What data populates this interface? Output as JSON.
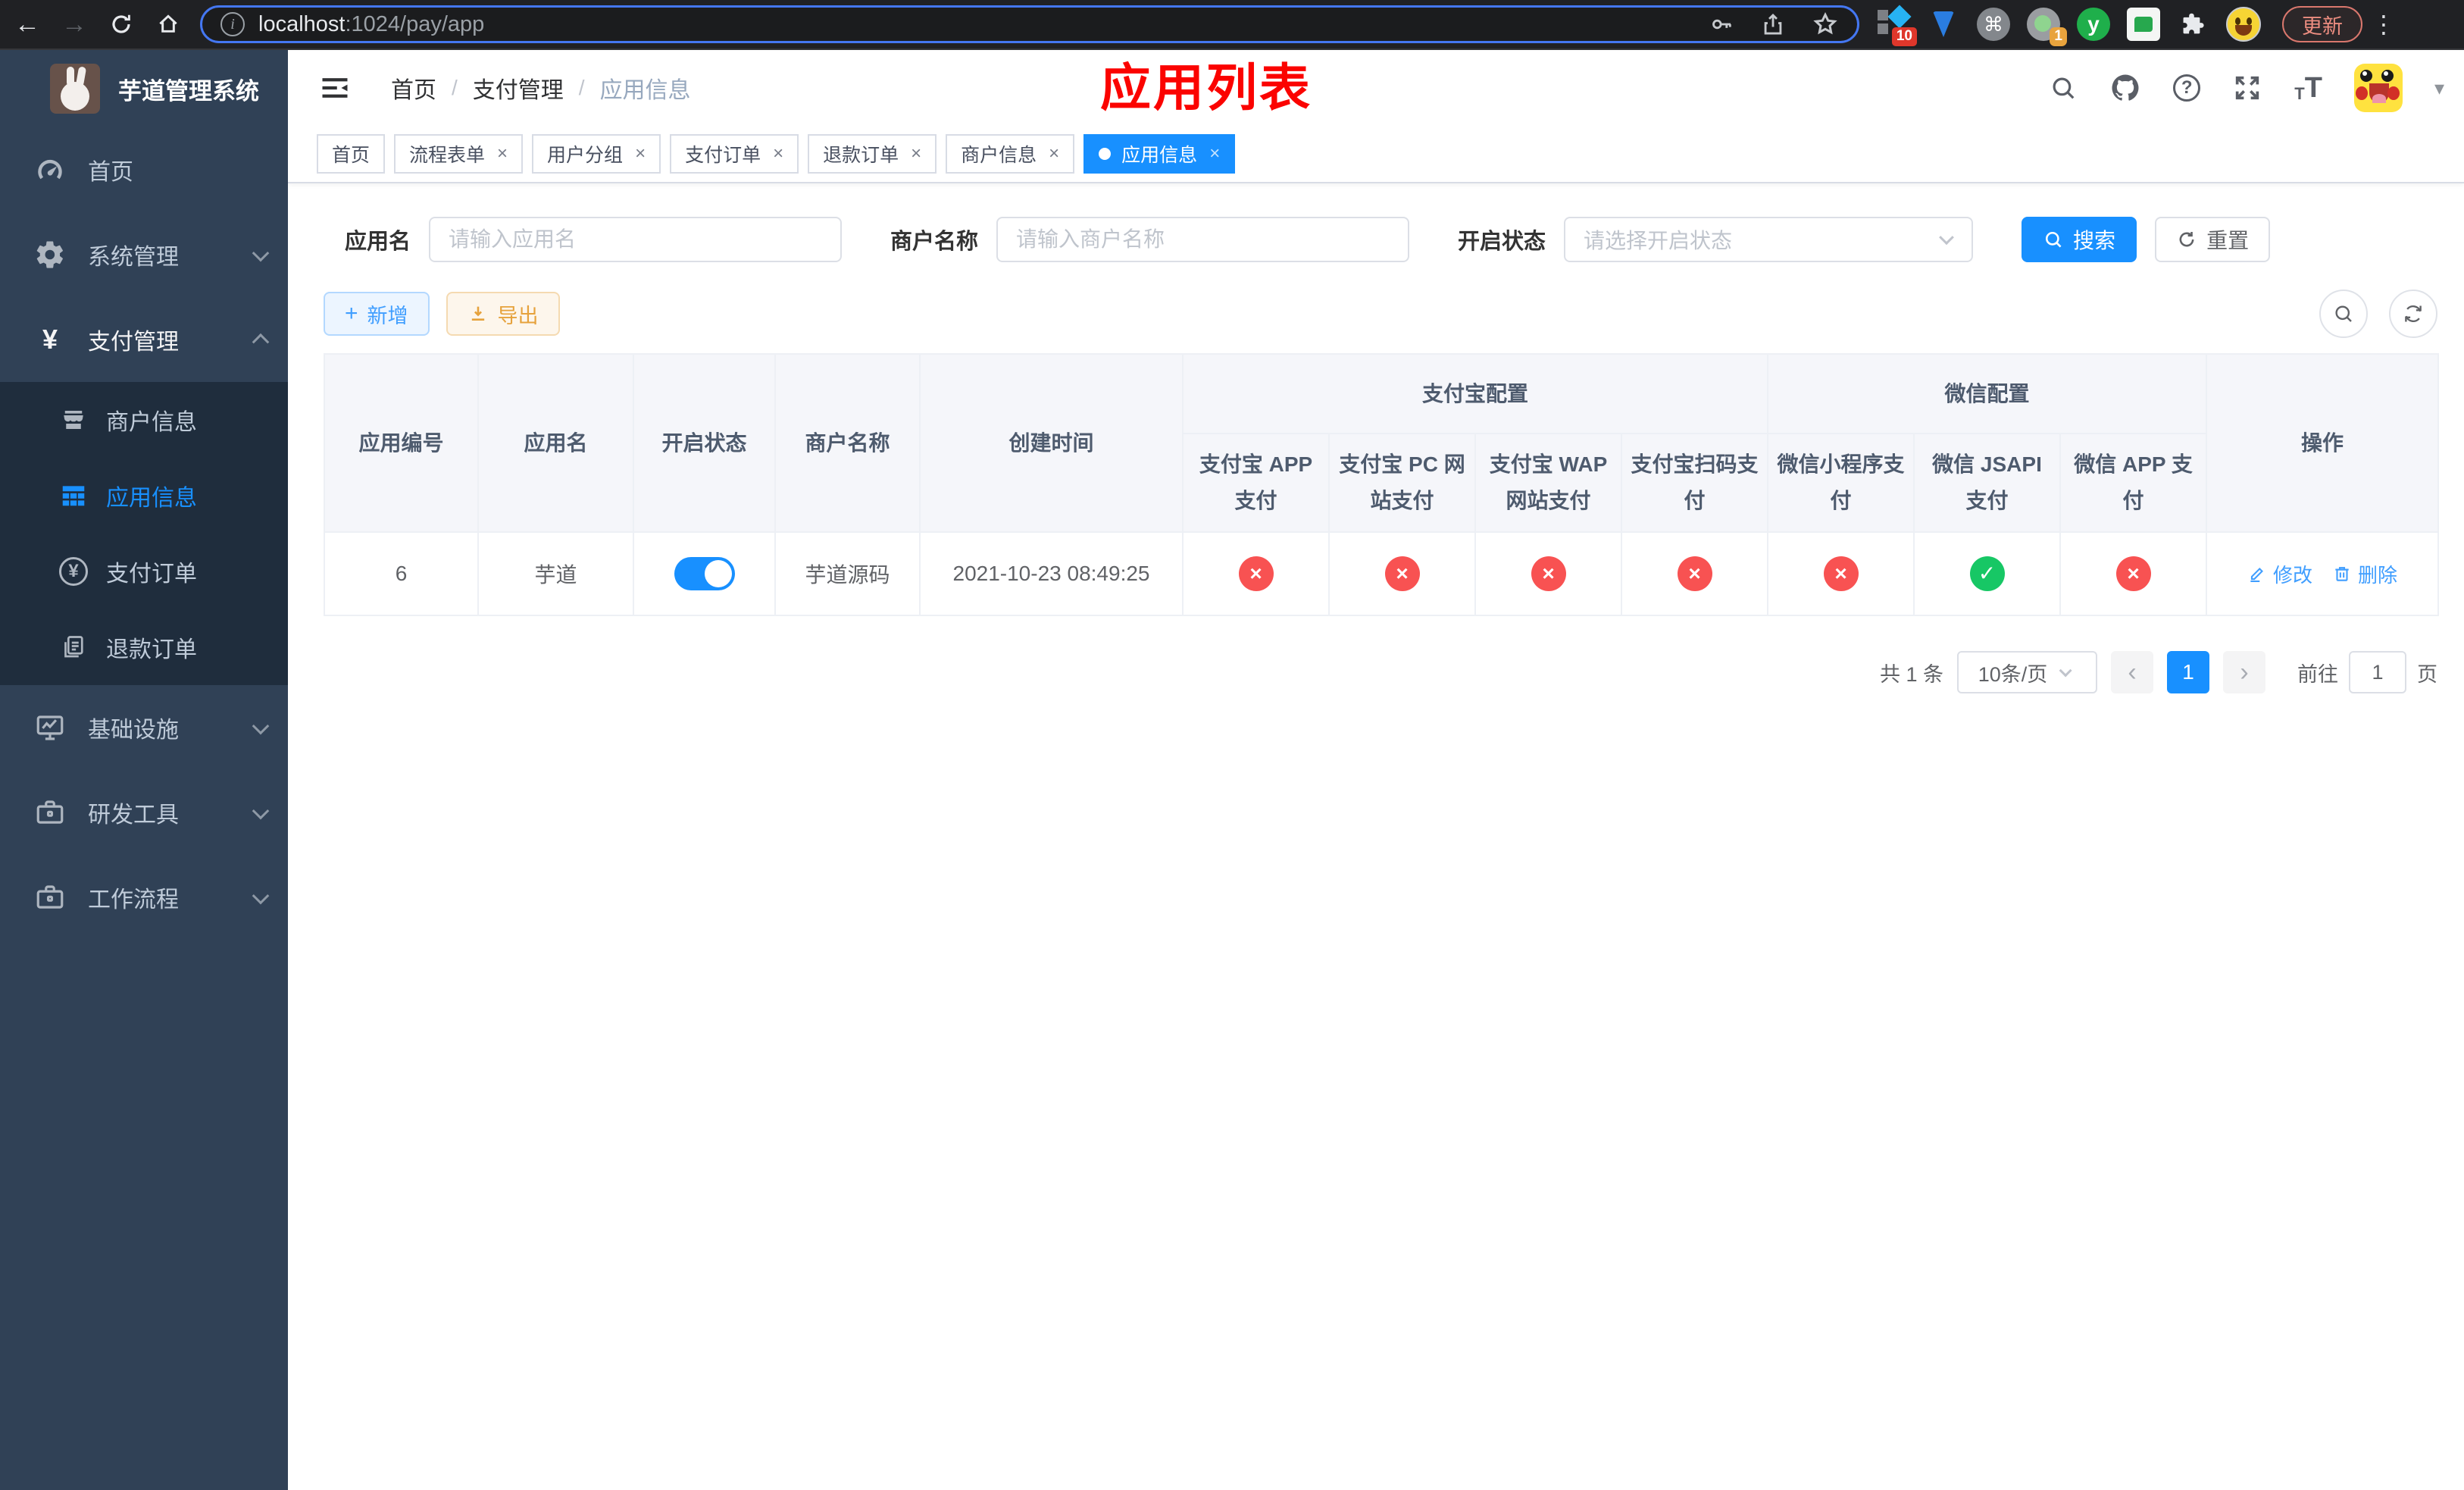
{
  "colors": {
    "accent": "#1890ff",
    "link": "#409eff",
    "danger": "#f85252",
    "success": "#17c765",
    "sidebar_bg": "#304156",
    "submenu_bg": "#1f2d3d",
    "annotation": "#fb0300"
  },
  "browser": {
    "url": {
      "host": "localhost",
      "path": ":1024/pay/app"
    },
    "update_button": "更新",
    "ext": {
      "badge_ten": "10",
      "badge_one": "1",
      "y_label": "y",
      "cmd_glyph": "⌘"
    }
  },
  "sidebar": {
    "title": "芋道管理系统",
    "menu": [
      {
        "label": "首页"
      },
      {
        "label": "系统管理"
      },
      {
        "label": "支付管理"
      },
      {
        "label": "基础设施"
      },
      {
        "label": "研发工具"
      },
      {
        "label": "工作流程"
      }
    ],
    "submenu": [
      {
        "label": "商户信息"
      },
      {
        "label": "应用信息"
      },
      {
        "label": "支付订单"
      },
      {
        "label": "退款订单"
      }
    ]
  },
  "navbar": {
    "breadcrumb": [
      "首页",
      "支付管理",
      "应用信息"
    ],
    "separator": "/"
  },
  "annotation": {
    "title": "应用列表"
  },
  "tabs": [
    {
      "label": "首页"
    },
    {
      "label": "流程表单"
    },
    {
      "label": "用户分组"
    },
    {
      "label": "支付订单"
    },
    {
      "label": "退款订单"
    },
    {
      "label": "商户信息"
    },
    {
      "label": "应用信息"
    }
  ],
  "tab_close_glyph": "×",
  "filters": {
    "app_name": {
      "label": "应用名",
      "placeholder": "请输入应用名"
    },
    "merchant_name": {
      "label": "商户名称",
      "placeholder": "请输入商户名称"
    },
    "status": {
      "label": "开启状态",
      "placeholder": "请选择开启状态"
    },
    "search_button": "搜索",
    "reset_button": "重置"
  },
  "toolbar": {
    "add_button": "新增",
    "export_button": "导出"
  },
  "table": {
    "group_headers": {
      "alipay": "支付宝配置",
      "wechat": "微信配置"
    },
    "columns": [
      "应用编号",
      "应用名",
      "开启状态",
      "商户名称",
      "创建时间",
      "支付宝 APP 支付",
      "支付宝 PC 网站支付",
      "支付宝 WAP 网站支付",
      "支付宝扫码支付",
      "微信小程序支付",
      "微信 JSAPI 支付",
      "微信 APP 支付",
      "操作"
    ],
    "glyphs": {
      "cross": "×",
      "check": "✓"
    },
    "row": {
      "id": "6",
      "name": "芋道",
      "switch_on": true,
      "merchant": "芋道源码",
      "created_at": "2021-10-23 08:49:25",
      "pay_status": [
        false,
        false,
        false,
        false,
        false,
        true,
        false
      ],
      "edit_label": "修改",
      "delete_label": "删除"
    }
  },
  "pagination": {
    "total": "共 1 条",
    "page_size": "10条/页",
    "current_page": "1",
    "prev_glyph": "‹",
    "next_glyph": "›",
    "goto_label": "前往",
    "goto_value": "1",
    "page_unit": "页"
  }
}
